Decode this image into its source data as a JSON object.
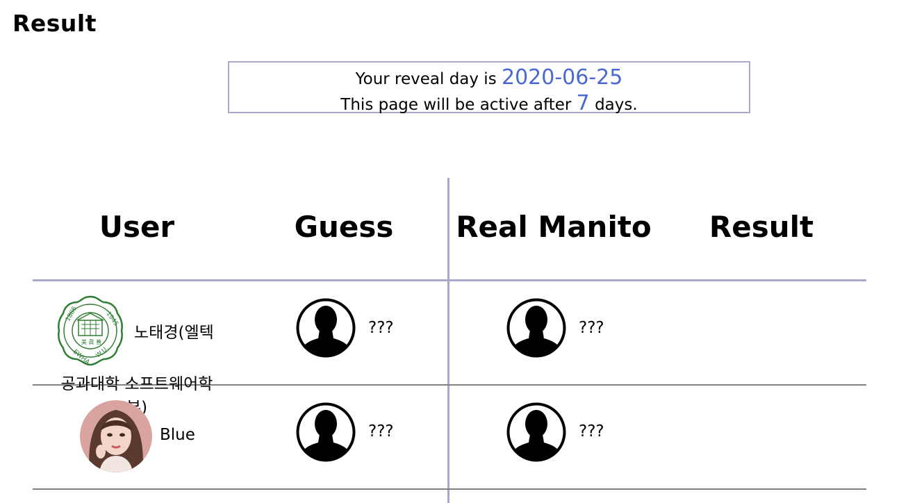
{
  "page": {
    "title": "Result"
  },
  "reveal": {
    "prefix": "Your reveal day is ",
    "date": "2020-06-25",
    "active_prefix": "This page will be active after ",
    "days": "7",
    "active_suffix": " days."
  },
  "table": {
    "headers": [
      "User",
      "Guess",
      "Real Manito",
      "Result"
    ],
    "rows": [
      {
        "user_name_line1": "노태경(엘텍",
        "user_name_line2": "공과대학 소프트웨어학",
        "user_name_line3": "부)",
        "guess": "???",
        "real": "???",
        "avatar": "ewha-university-logo"
      },
      {
        "user_name": "Blue",
        "guess": "???",
        "real": "???",
        "avatar": "profile-photo"
      }
    ]
  },
  "colors": {
    "accent": "#4a68d2",
    "divider": "#a8a8c8",
    "row_line": "#808080",
    "logo_green": "#2e7d32"
  }
}
